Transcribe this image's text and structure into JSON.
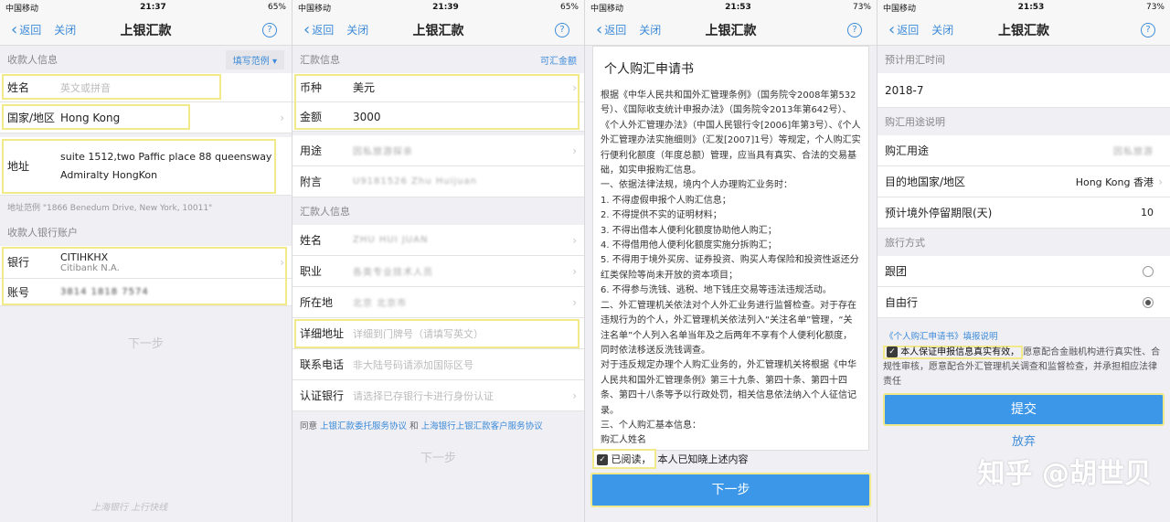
{
  "common": {
    "carrier": "中国移动",
    "back": "返回",
    "close": "关闭",
    "title": "上银汇款",
    "help": "?",
    "battery65": "65%",
    "battery73": "73%"
  },
  "p1": {
    "time": "21:37",
    "sec_payee": "收款人信息",
    "example": "填写范例",
    "name_label": "姓名",
    "name_ph": "英文或拼音",
    "country_label": "国家/地区",
    "country_val": "Hong Kong",
    "addr_label": "地址",
    "addr_line1": "suite 1512,two Paffic place 88 queensway",
    "addr_line2": "Admiralty HongKon",
    "addr_hint": "地址范例 \"1866 Benedum Drive, New York, 10011\"",
    "sec_bank": "收款人银行账户",
    "bank_label": "银行",
    "bank_val": "CITIHKHX",
    "bank_sub": "Citibank N.A.",
    "acct_label": "账号",
    "acct_val": "3814 1818 7574",
    "next": "下一步",
    "logo": "上海银行 上行快线"
  },
  "p2": {
    "time": "21:39",
    "sec_remit": "汇款信息",
    "avail": "可汇金额",
    "cur_label": "币种",
    "cur_val": "美元",
    "amt_label": "金额",
    "amt_val": "3000",
    "use_label": "用途",
    "use_val": "因私旅游探亲",
    "note_label": "附言",
    "note_val": "U9181526 Zhu Huijuan",
    "sec_sender": "汇款人信息",
    "name_label": "姓名",
    "name_val": "ZHU HUI JUAN",
    "job_label": "职业",
    "job_val": "各类专业技术人员",
    "loc_label": "所在地",
    "loc_val": "北京 北京市",
    "detail_label": "详细地址",
    "detail_ph": "详细到门牌号（请填写英文）",
    "phone_label": "联系电话",
    "phone_ph": "非大陆号码请添加国际区号",
    "bank_label": "认证银行",
    "bank_ph": "请选择已存银行卡进行身份认证",
    "agree_pre": "同意",
    "agree_link1": "上银汇款委托服务协议",
    "agree_and": "和",
    "agree_link2": "上海银行上银汇款客户服务协议",
    "next": "下一步"
  },
  "p3": {
    "time": "21:53",
    "doc_title": "个人购汇申请书",
    "doc_text": "根据《中华人民共和国外汇管理条例》（国务院令2008年第532号）、《国际收支统计申报办法》（国务院令2013年第642号）、《个人外汇管理办法》（中国人民银行令[2006]年第3号）、《个人外汇管理办法实施细则》（汇发[2007]1号）等规定，个人购汇实行便利化额度（年度总额）管理，应当具有真实、合法的交易基础，如实申报购汇信息。",
    "item0": "一、依据法律法规，境内个人办理购汇业务时：",
    "item1": "1. 不得虚假申报个人购汇信息；",
    "item2": "2. 不得提供不实的证明材料；",
    "item3": "3. 不得出借本人便利化额度协助他人购汇；",
    "item4": "4. 不得借用他人便利化额度实施分拆购汇；",
    "item5": "5. 不得用于境外买房、证券投资、购买人寿保险和投资性返还分红类保险等尚未开放的资本项目；",
    "item6": "6. 不得参与洗钱、逃税、地下钱庄交易等违法违规活动。",
    "item7": "二、外汇管理机关依法对个人外汇业务进行监督检查。对于存在违规行为的个人，外汇管理机关依法列入“关注名单”管理，“关注名单”个人列入名单当年及之后两年不享有个人便利化额度，同时依法移送反洗钱调查。",
    "item8": "对于违反规定办理个人购汇业务的，外汇管理机关将根据《中华人民共和国外汇管理条例》第三十九条、第四十条、第四十四条、第四十八条等予以行政处罚，相关信息依法纳入个人征信记录。",
    "item9": "三、个人购汇基本信息：",
    "item10": "购汇人姓名",
    "read_chk": "已阅读，",
    "read_text": "本人已知晓上述内容",
    "next": "下一步"
  },
  "p4": {
    "time": "21:53",
    "sec_time": "预计用汇时间",
    "time_val": "2018-7",
    "sec_use": "购汇用途说明",
    "use_label": "购汇用途",
    "use_val": "因私旅游",
    "dest_label": "目的地国家/地区",
    "dest_val": "Hong Kong 香港",
    "stay_label": "预计境外停留期限(天)",
    "stay_val": "10",
    "sec_travel": "旅行方式",
    "opt1": "跟团",
    "opt2": "自由行",
    "link": "《个人购汇申请书》填报说明",
    "guarantee_bold": "本人保证申报信息真实有效，",
    "guarantee_rest": "愿意配合金融机构进行真实性、合规性审核，愿意配合外汇管理机关调查和监督检查，并承担相应法律责任",
    "submit": "提交",
    "abandon": "放弃",
    "watermark": "知乎 @胡世贝"
  }
}
